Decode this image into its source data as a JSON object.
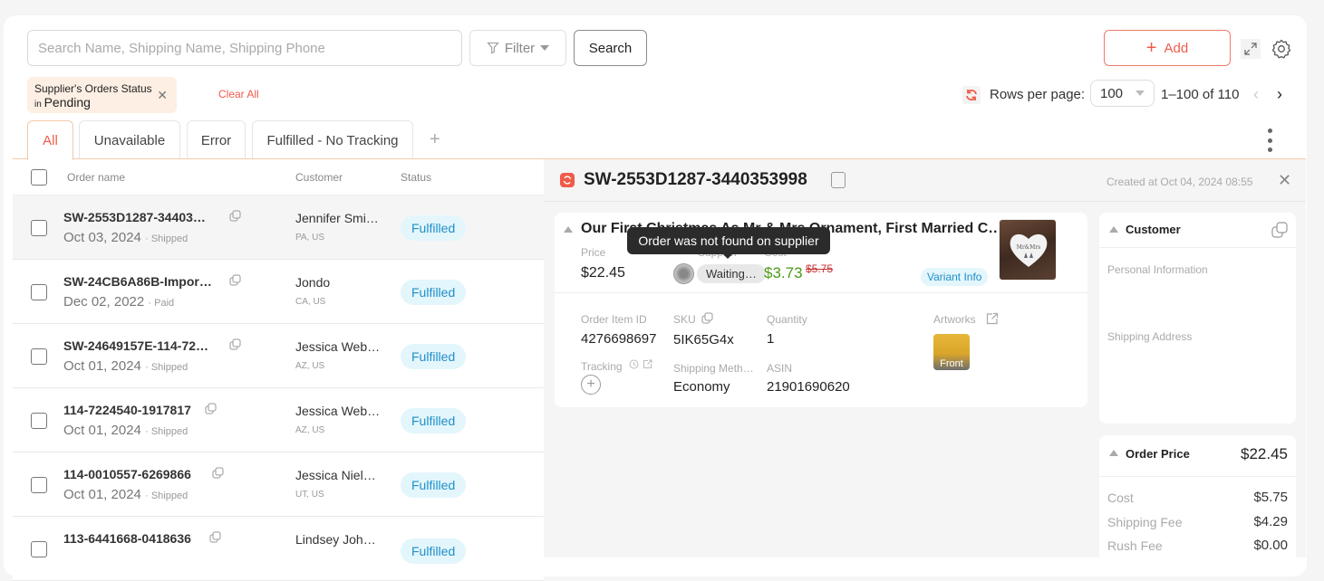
{
  "toolbar": {
    "search_placeholder": "Search Name, Shipping Name, Shipping Phone",
    "search_value": "",
    "filter_label": "Filter",
    "search_button": "Search",
    "add_button": "Add"
  },
  "filter_chip": {
    "field": "Supplier's Orders Status",
    "operator": "in",
    "value": "Pending",
    "clear_all": "Clear All"
  },
  "pagination": {
    "rows_per_page_label": "Rows per page:",
    "rows_per_page": "100",
    "range": "1–100 of 110"
  },
  "tabs": [
    {
      "label": "All",
      "active": true
    },
    {
      "label": "Unavailable"
    },
    {
      "label": "Error"
    },
    {
      "label": "Fulfilled - No Tracking"
    }
  ],
  "tab_add": "+",
  "list": {
    "columns": [
      "Order name",
      "Customer",
      "Status"
    ],
    "rows": [
      {
        "order": "SW-2553D1287-34403…",
        "date": "Oct 03, 2024",
        "sub": "Shipped",
        "customer": "Jennifer Smi…",
        "location": "PA, US",
        "status": "Fulfilled",
        "selected": true
      },
      {
        "order": "SW-24CB6A86B-Impor…",
        "date": "Dec 02, 2022",
        "sub": "Paid",
        "customer": "Jondo",
        "location": "CA, US",
        "status": "Fulfilled"
      },
      {
        "order": "SW-24649157E-114-72…",
        "date": "Oct 01, 2024",
        "sub": "Shipped",
        "customer": "Jessica Web…",
        "location": "AZ, US",
        "status": "Fulfilled"
      },
      {
        "order": "114-7224540-1917817",
        "date": "Oct 01, 2024",
        "sub": "Shipped",
        "customer": "Jessica Web…",
        "location": "AZ, US",
        "status": "Fulfilled"
      },
      {
        "order": "114-0010557-6269866",
        "date": "Oct 01, 2024",
        "sub": "Shipped",
        "customer": "Jessica Niel…",
        "location": "UT, US",
        "status": "Fulfilled"
      },
      {
        "order": "113-6441668-0418636",
        "date": "",
        "sub": "",
        "customer": "Lindsey Joh…",
        "location": "",
        "status": "Fulfilled"
      }
    ]
  },
  "detail": {
    "title": "SW-2553D1287-3440353998",
    "created": "Created at Oct 04, 2024 08:55",
    "item": {
      "product_title": "Our First Christmas As Mr & Mrs Ornament, First Married C…",
      "price_label": "Price",
      "price": "$22.45",
      "supplier_label": "Supplier",
      "supplier_status": "Waiting…",
      "cost_label": "Cost",
      "cost": "$3.73",
      "cost_original": "$5.75",
      "variant_info": "Variant Info",
      "tooltip": "Order was not found on supplier",
      "order_item_id_label": "Order Item ID",
      "order_item_id": "4276698697",
      "sku_label": "SKU",
      "sku": "5IK65G4x",
      "quantity_label": "Quantity",
      "quantity": "1",
      "artworks_label": "Artworks",
      "artwork_side": "Front",
      "tracking_label": "Tracking",
      "shipping_method_label": "Shipping Meth…",
      "shipping_method": "Economy",
      "asin_label": "ASIN",
      "asin": "21901690620"
    },
    "customer": {
      "title": "Customer",
      "personal_info_label": "Personal Information",
      "shipping_address_label": "Shipping Address"
    },
    "order_price": {
      "title": "Order Price",
      "total": "$22.45",
      "lines": [
        {
          "label": "Cost",
          "value": "$5.75"
        },
        {
          "label": "Shipping Fee",
          "value": "$4.29"
        },
        {
          "label": "Rush Fee",
          "value": "$0.00"
        }
      ]
    }
  },
  "colors": {
    "accent": "#ef5b4a",
    "status_fulfilled_bg": "#e3f6fc",
    "status_fulfilled_text": "#1f8fc9",
    "cost_green": "#4a9a16",
    "chip_bg": "#fdefe3"
  }
}
